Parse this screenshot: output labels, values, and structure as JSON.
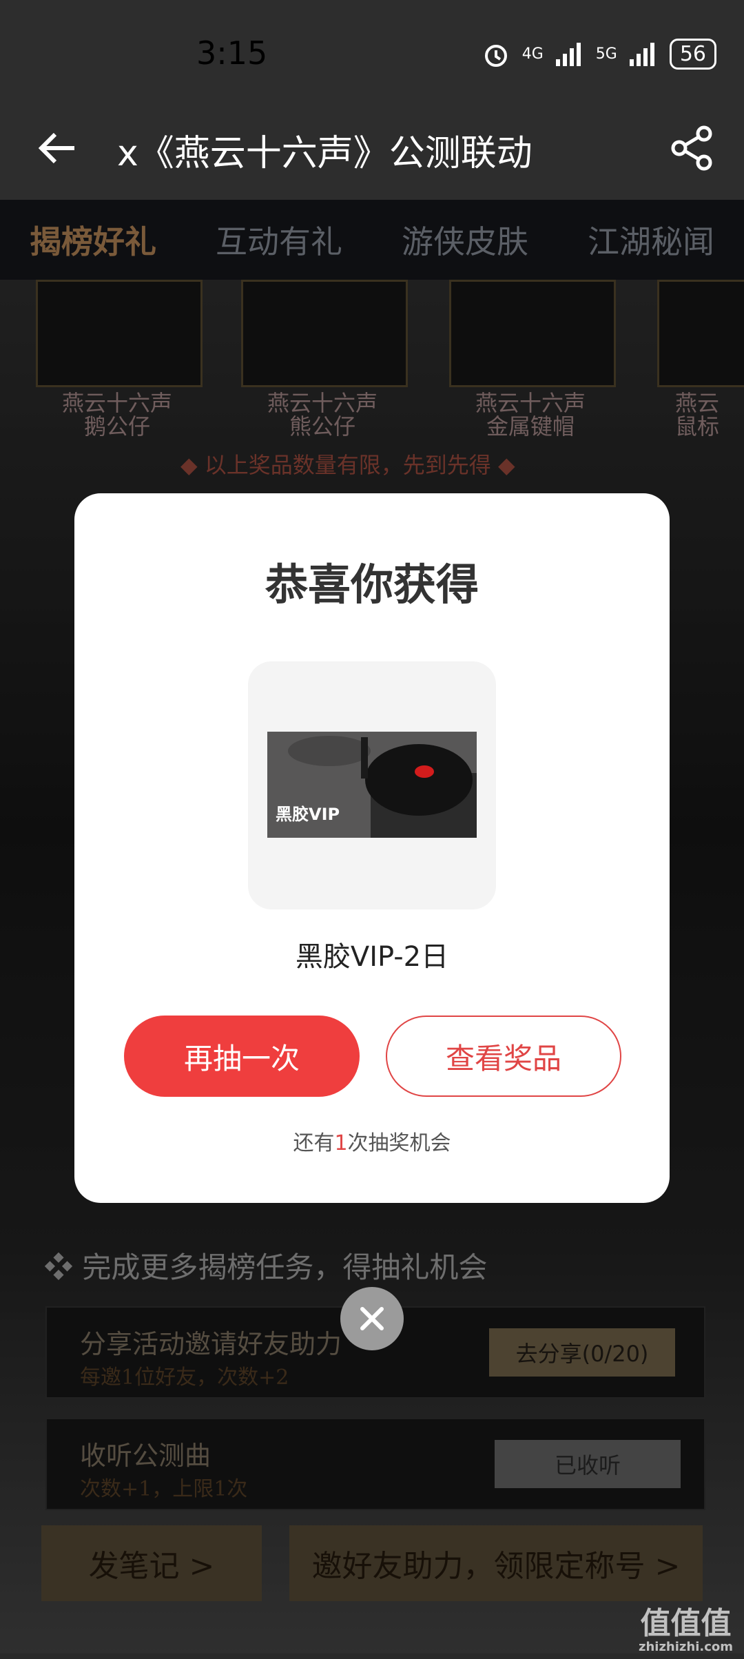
{
  "status_bar": {
    "time": "3:15",
    "net1": "4G",
    "net2": "5G",
    "battery": "56"
  },
  "header": {
    "title": "x《燕云十六声》公测联动"
  },
  "tabs": [
    {
      "label": "揭榜好礼",
      "active": true
    },
    {
      "label": "互动有礼",
      "active": false
    },
    {
      "label": "游侠皮肤",
      "active": false
    },
    {
      "label": "江湖秘闻",
      "active": false
    }
  ],
  "prizes": [
    {
      "name1": "燕云十六声",
      "name2": "鹅公仔"
    },
    {
      "name1": "燕云十六声",
      "name2": "熊公仔"
    },
    {
      "name1": "燕云十六声",
      "name2": "金属键帽"
    },
    {
      "name1": "燕云",
      "name2": "鼠标"
    }
  ],
  "limit_note": "◆ 以上奖品数量有限，先到先得 ◆",
  "tasks": {
    "title": "❖ 完成更多揭榜任务，得抽礼机会",
    "items": [
      {
        "name": "分享活动邀请好友助力",
        "sub": "每邀1位好友，次数+2",
        "button": "去分享(0/20)"
      },
      {
        "name": "收听公测曲",
        "sub": "次数+1，上限1次",
        "button": "已收听"
      }
    ]
  },
  "bottom": {
    "left": "发笔记 >",
    "right": "邀好友助力，领限定称号 >"
  },
  "modal": {
    "title": "恭喜你获得",
    "prize_image_text": "黑胶VIP",
    "prize_name": "黑胶VIP-2日",
    "primary_button": "再抽一次",
    "secondary_button": "查看奖品",
    "chance_prefix": "还有",
    "chance_count": "1",
    "chance_suffix": "次抽奖机会"
  },
  "watermark": {
    "text": "值值值",
    "sub": "zhizhizhi.com"
  },
  "colors": {
    "accent": "#ef3e3e",
    "header_bg": "#2d2d2d",
    "tab_bar_bg": "#0e0f12"
  }
}
